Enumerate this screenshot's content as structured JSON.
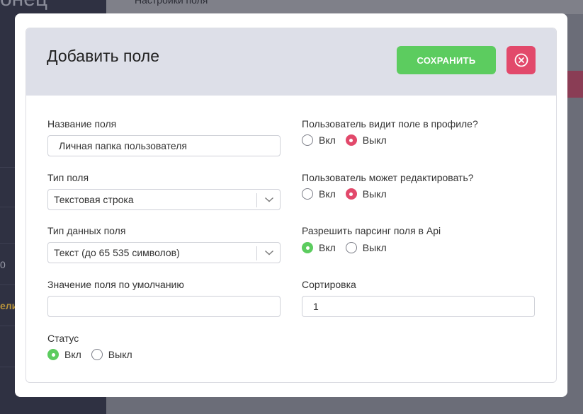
{
  "background": {
    "logo_text": "онец",
    "topbar_text": "Настройки поля",
    "side_text_1": "0",
    "side_text_2": "ели",
    "side_text_3": ""
  },
  "modal": {
    "title": "Добавить поле",
    "save_label": "СОХРАНИТЬ",
    "accent_green": "#5ccc5f",
    "accent_pink": "#e2496b"
  },
  "left": {
    "field_name": {
      "label": "Название поля",
      "value": "Личная папка пользователя"
    },
    "field_type": {
      "label": "Тип поля",
      "value": "Текстовая строка"
    },
    "data_type": {
      "label": "Тип данных поля",
      "value": "Текст (до 65 535 символов)"
    },
    "default_value": {
      "label": "Значение поля по умолчанию",
      "value": ""
    },
    "status": {
      "label": "Статус",
      "on": "Вкл",
      "off": "Выкл",
      "selected": "on"
    }
  },
  "right": {
    "visible_in_profile": {
      "label": "Пользователь видит поле в профиле?",
      "on": "Вкл",
      "off": "Выкл",
      "selected": "off"
    },
    "can_edit": {
      "label": "Пользователь может редактировать?",
      "on": "Вкл",
      "off": "Выкл",
      "selected": "off"
    },
    "api_parsing": {
      "label": "Разрешить парсинг поля в Api",
      "on": "Вкл",
      "off": "Выкл",
      "selected": "on"
    },
    "sorting": {
      "label": "Сортировка",
      "value": "1"
    }
  }
}
